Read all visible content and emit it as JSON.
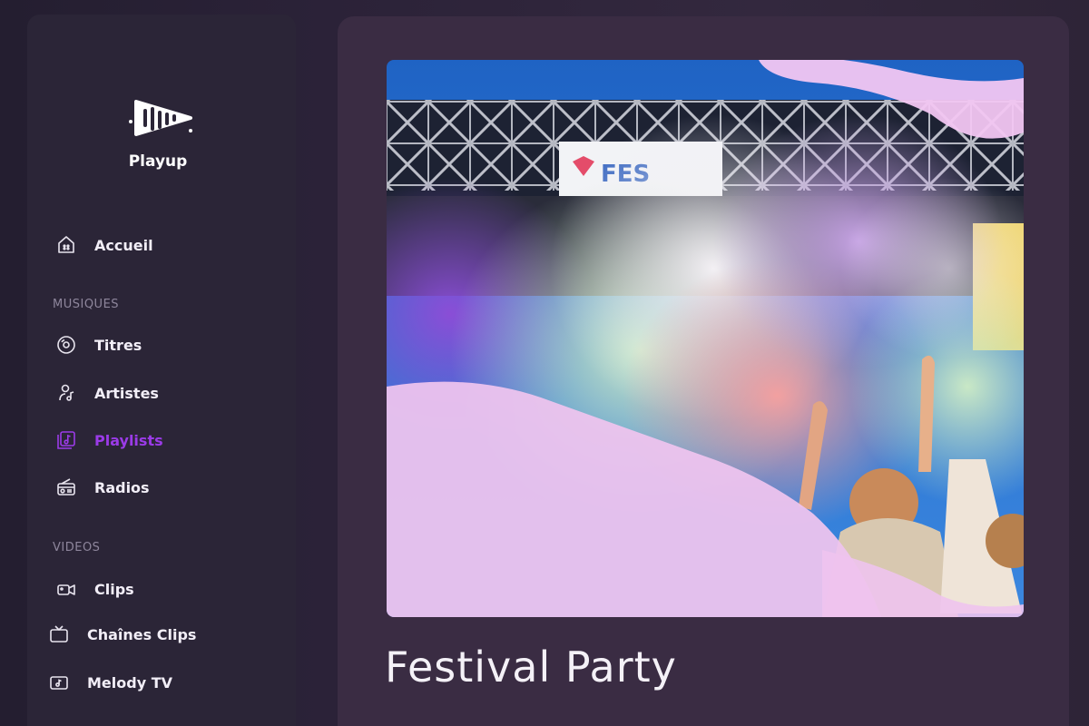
{
  "app": {
    "name": "Playup"
  },
  "sidebar": {
    "home_label": "Accueil",
    "sections": [
      {
        "label": "MUSIQUES",
        "items": [
          {
            "label": "Titres",
            "icon": "disc-icon"
          },
          {
            "label": "Artistes",
            "icon": "artist-icon"
          },
          {
            "label": "Playlists",
            "icon": "playlist-icon",
            "active": true
          },
          {
            "label": "Radios",
            "icon": "radio-icon"
          }
        ]
      },
      {
        "label": "VIDEOS",
        "items": [
          {
            "label": "Clips",
            "icon": "video-camera-icon"
          },
          {
            "label": "Chaînes Clips",
            "icon": "tv-icon"
          },
          {
            "label": "Melody TV",
            "icon": "music-tv-icon"
          }
        ]
      }
    ]
  },
  "playlist": {
    "title": "Festival Party"
  },
  "colors": {
    "accent": "#9b3be8",
    "background": "#2a2236",
    "sidebar": "#2b2537",
    "overlay_pink": "#f0c4f0"
  }
}
